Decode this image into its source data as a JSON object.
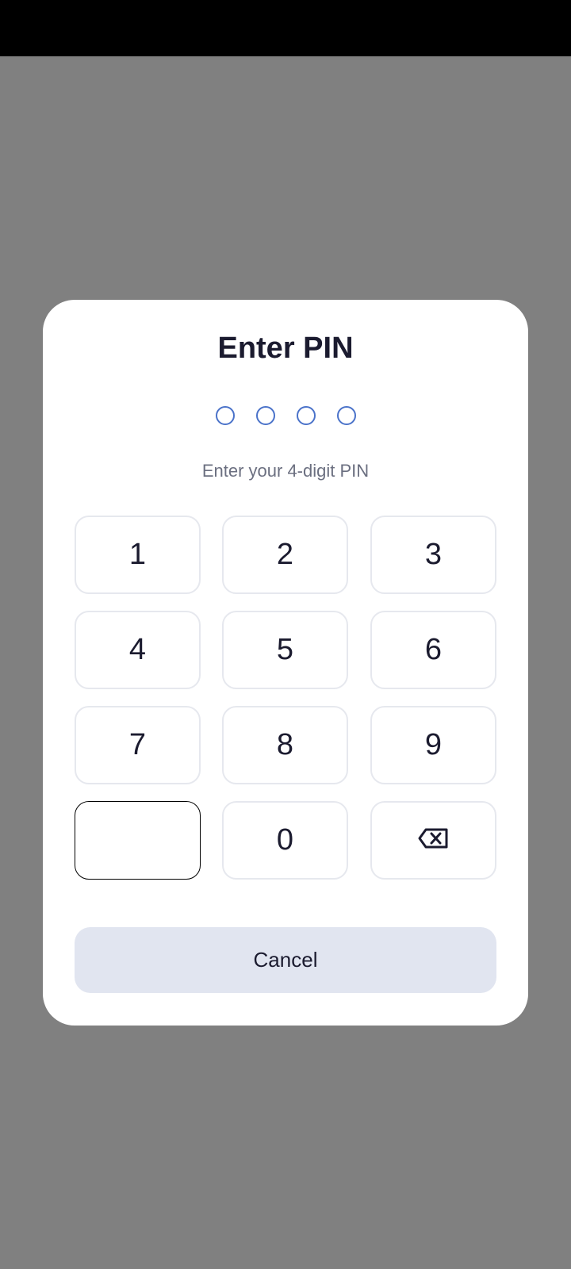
{
  "dialog": {
    "title": "Enter PIN",
    "hint": "Enter your 4-digit PIN",
    "pin_length": 4,
    "pin_entered": 0
  },
  "keypad": {
    "keys": [
      "1",
      "2",
      "3",
      "4",
      "5",
      "6",
      "7",
      "8",
      "9",
      "",
      "0",
      "backspace-icon"
    ]
  },
  "actions": {
    "cancel_label": "Cancel"
  },
  "colors": {
    "status_bar": "#000000",
    "scrim": "#808080",
    "dot_outline": "#4a72c9",
    "cancel_bg": "#e1e5f0"
  }
}
